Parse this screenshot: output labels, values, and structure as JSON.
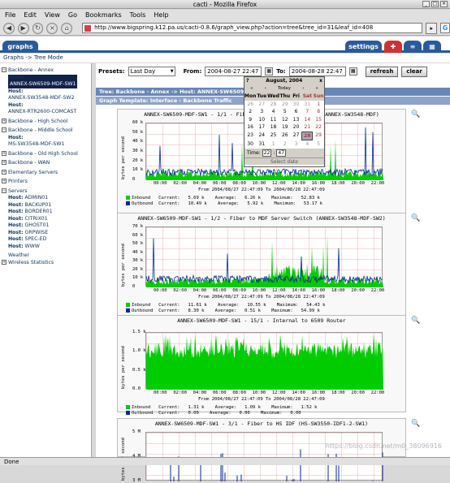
{
  "window": {
    "title": "cacti - Mozilla Firefox"
  },
  "menu": [
    "File",
    "Edit",
    "View",
    "Go",
    "Bookmarks",
    "Tools",
    "Help"
  ],
  "navbar": {
    "url": "http://www.bigspring.k12.pa.us/cacti-0.8.6/graph_view.php?action=tree&tree_id=31&leaf_id=408"
  },
  "tabs": {
    "graphs": "graphs",
    "settings": "settings"
  },
  "breadcrumb": "Graphs -> Tree Mode",
  "sidebar": {
    "items": [
      {
        "type": "tree",
        "label": "Backbone - Annex",
        "toggle": "−"
      },
      {
        "type": "host",
        "prefix": "Host:",
        "label": "ANNEX-SW6509-MDF-SW1",
        "selected": true
      },
      {
        "type": "host",
        "prefix": "Host:",
        "label": "ANNEX-SW3548-MDF-SW2"
      },
      {
        "type": "host",
        "prefix": "Host:",
        "label": "ANNEX-RTR2600-COMCAST"
      },
      {
        "type": "tree",
        "label": "Backbone - High School",
        "toggle": "+"
      },
      {
        "type": "tree",
        "label": "Backbone - Middle School",
        "toggle": "−"
      },
      {
        "type": "host",
        "prefix": "Host:",
        "label": "MS-SW3548-MDF-SW1"
      },
      {
        "type": "tree",
        "label": "Backbone - Old High School",
        "toggle": "+"
      },
      {
        "type": "tree",
        "label": "Backbone - WAN",
        "toggle": "+"
      },
      {
        "type": "tree",
        "label": "Elementary Servers",
        "toggle": "+"
      },
      {
        "type": "tree",
        "label": "Printers",
        "toggle": "+"
      },
      {
        "type": "tree",
        "label": "Servers",
        "toggle": "−"
      },
      {
        "type": "host",
        "prefix": "Host:",
        "label": "ADMIN01"
      },
      {
        "type": "host",
        "prefix": "Host:",
        "label": "BACKUP01"
      },
      {
        "type": "host",
        "prefix": "Host:",
        "label": "BORDER01"
      },
      {
        "type": "host",
        "prefix": "Host:",
        "label": "CITRIX01"
      },
      {
        "type": "host",
        "prefix": "Host:",
        "label": "GHOST01"
      },
      {
        "type": "host",
        "prefix": "Host:",
        "label": "GRPWISE"
      },
      {
        "type": "host",
        "prefix": "Host:",
        "label": "SPEC-ED"
      },
      {
        "type": "host",
        "prefix": "Host:",
        "label": "WWW"
      },
      {
        "type": "plain",
        "label": "Weather"
      },
      {
        "type": "tree",
        "label": "Wireless Statistics",
        "toggle": "+"
      }
    ]
  },
  "presets": {
    "presets_label": "Presets:",
    "preset_value": "Last Day",
    "from_label": "From:",
    "from_value": "2004-08-27 22:47",
    "to_label": "To:",
    "to_value": "2004-08-28 22:47",
    "refresh": "refresh",
    "clear": "clear"
  },
  "tree_header": {
    "prefix": "Tree:",
    "tree": "Backbone - Annex",
    "sep": "->",
    "host_prefix": "Host:",
    "host": "ANNEX-SW6509-MDF-SW1"
  },
  "template_header": {
    "prefix": "Graph Template:",
    "value": "Interface - Backbone Traffic"
  },
  "calendar": {
    "help": "?",
    "month": "August, 2004",
    "close": "x",
    "nav": [
      "«",
      "‹",
      "Today",
      "›",
      "»"
    ],
    "days": [
      "Mon",
      "Tue",
      "Wed",
      "Thu",
      "Fri",
      "Sat",
      "Sun"
    ],
    "weeks": [
      [
        "26",
        "27",
        "28",
        "29",
        "30",
        "31",
        "1"
      ],
      [
        "2",
        "3",
        "4",
        "5",
        "6",
        "7",
        "8"
      ],
      [
        "9",
        "10",
        "11",
        "12",
        "13",
        "14",
        "15"
      ],
      [
        "16",
        "17",
        "18",
        "19",
        "20",
        "21",
        "22"
      ],
      [
        "23",
        "24",
        "25",
        "26",
        "27",
        "28",
        "29"
      ],
      [
        "30",
        "31",
        "1",
        "2",
        "3",
        "4",
        "5"
      ]
    ],
    "today": "28",
    "time_label": "Time:",
    "hour": "22",
    "minute": "47",
    "footer": "Select date"
  },
  "graphs": [
    {
      "title": "ANNEX-SW6509-MDF-SW1 - 1/1 - Fiber to MDF Server Switch (ANNEX-SW3548-MDF)",
      "ylabel": "bytes per second",
      "yticks": [
        "60 k",
        "50 k",
        "40 k",
        "30 k",
        "20 k",
        "10 k",
        "0"
      ],
      "xticks": [
        "00:00",
        "02:00",
        "04:00",
        "06:00",
        "08:00",
        "10:00",
        "12:00",
        "14:00",
        "16:00",
        "18:00",
        "20:00",
        "22:00"
      ],
      "from_to": "From 2004/08/27 22:47:09 To 2004/08/28 22:47:09",
      "inbound": {
        "label": "Inbound",
        "current": "5.69 k",
        "average": "6.26 k",
        "maximum": "52.83 k"
      },
      "outbound": {
        "label": "Outbound",
        "current": "10.49 k",
        "average": "5.92 k",
        "maximum": "53.17 k"
      }
    },
    {
      "title": "ANNEX-SW6509-MDF-SW1 - 1/2 - Fiber to MDF Server Switch (ANNEX-SW3548-MDF-SW2)",
      "ylabel": "bytes per second",
      "yticks": [
        "70 k",
        "60 k",
        "50 k",
        "40 k",
        "30 k",
        "20 k",
        "10 k",
        "0"
      ],
      "xticks": [
        "00:00",
        "02:00",
        "04:00",
        "06:00",
        "08:00",
        "10:00",
        "12:00",
        "14:00",
        "16:00",
        "18:00",
        "20:00",
        "22:00"
      ],
      "from_to": "From 2004/08/27 22:47:09 To 2004/08/28 22:47:09",
      "inbound": {
        "label": "Inbound",
        "current": "11.61 k",
        "average": "10.55 k",
        "maximum": "54.43 k"
      },
      "outbound": {
        "label": "Outbound",
        "current": "8.30 k",
        "average": "0.51 k",
        "maximum": "54.99 k"
      }
    },
    {
      "title": "ANNEX-SW6509-MDF-SW1 - 15/1 - Internal to 6509 Router",
      "ylabel": "bytes per second",
      "yticks": [
        "1.5 k",
        "1.0 k",
        "0.5 k",
        "0.0"
      ],
      "xticks": [
        "00:00",
        "02:00",
        "04:00",
        "06:00",
        "08:00",
        "10:00",
        "12:00",
        "14:00",
        "16:00",
        "18:00",
        "20:00",
        "22:00"
      ],
      "from_to": "From 2004/08/27 22:47:09 To 2004/08/28 22:47:09",
      "inbound": {
        "label": "Inbound",
        "current": "1.31 k",
        "average": "1.09 k",
        "maximum": "1.52 k"
      },
      "outbound": {
        "label": "Outbound",
        "current": "0.00",
        "average": "0.00",
        "maximum": "0.00"
      }
    },
    {
      "title": "ANNEX-SW6509-MDF-SW1 - 3/1 - Fiber to HS IDF (HS-SW3550-IDF1-2-SW1)",
      "ylabel": "bytes per second",
      "yticks": [
        "5 M",
        "4 M",
        "3 M"
      ]
    }
  ],
  "statusbar": "Done",
  "watermark": "https://blog.csdn.net/m0_38096916",
  "colors": {
    "inbound": "#00cc00",
    "outbound": "#002a97",
    "accent": "#2a5a9a"
  }
}
